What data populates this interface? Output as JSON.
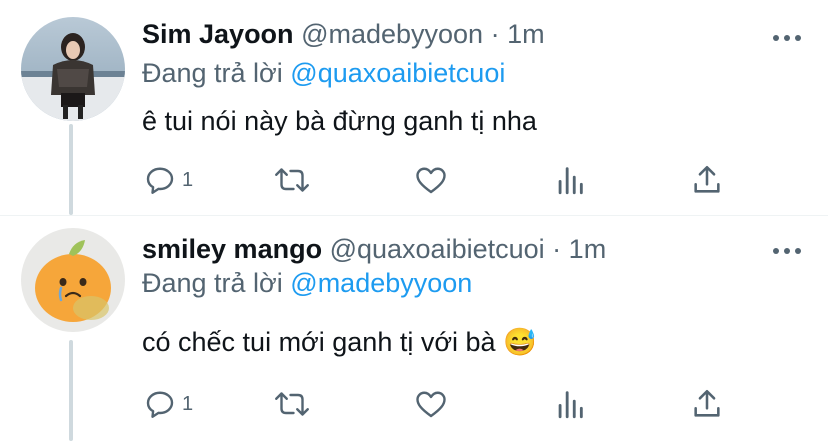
{
  "tweets": [
    {
      "author_name": "Sim Jayoon",
      "author_handle": "@madebyyoon",
      "separator": "·",
      "time": "1m",
      "reply_prefix": "Đang trả lời",
      "reply_to": "@quaxoaibietcuoi",
      "text": "ê tui nói này bà đừng ganh tị nha",
      "reply_count": "1"
    },
    {
      "author_name": "smiley mango",
      "author_handle": "@quaxoaibietcuoi",
      "separator": "·",
      "time": "1m",
      "reply_prefix": "Đang trả lời",
      "reply_to": "@madebyyoon",
      "text": "có chếc tui mới ganh tị với bà 😅",
      "reply_count": "1"
    }
  ],
  "icons": {
    "reply": "reply-icon",
    "retweet": "retweet-icon",
    "like": "heart-icon",
    "views": "analytics-icon",
    "share": "share-icon",
    "more": "more-icon"
  },
  "colors": {
    "link": "#1d9bf0",
    "secondary_text": "#536471",
    "thread_line": "#cfd9de"
  }
}
